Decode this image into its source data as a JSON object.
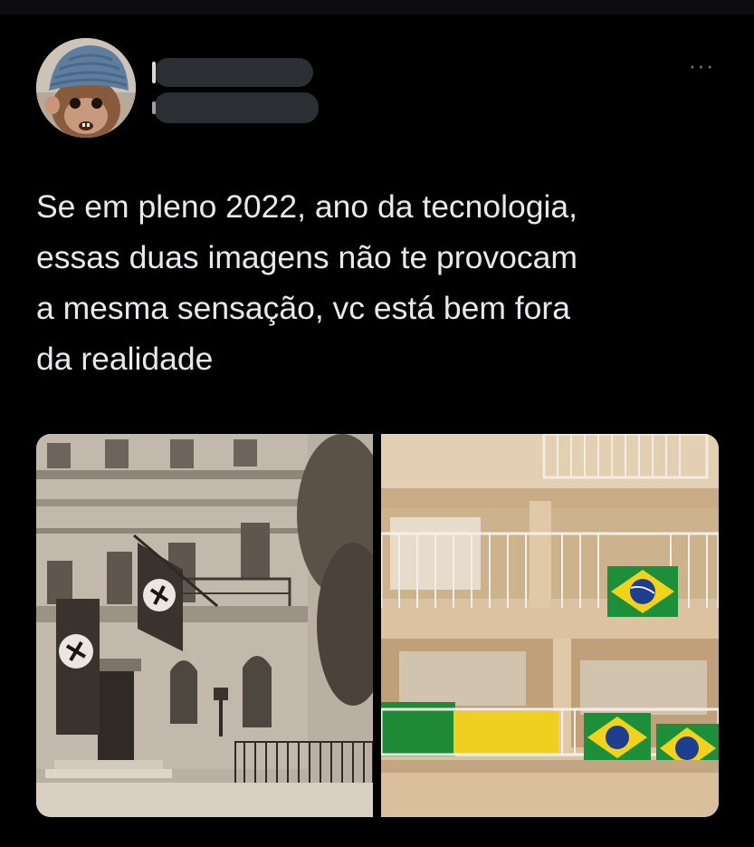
{
  "tweet": {
    "author_name": "",
    "author_handle": "",
    "text": "Se em pleno 2022, ano da tecnologia, essas duas imagens não te provocam a mesma sensação, vc está bem fora da realidade",
    "text_lines": [
      "Se em pleno 2022, ano da tecnologia,",
      "essas duas imagens não te provocam",
      "a mesma sensação, vc está bem fora",
      "da realidade"
    ],
    "more_icon": "more-horizontal-icon",
    "more_glyph": "···"
  },
  "media": {
    "count": 2
  },
  "colors": {
    "background": "#000000",
    "text": "#e7e9ea",
    "muted": "#71767b",
    "redaction": "#2b2f33"
  }
}
